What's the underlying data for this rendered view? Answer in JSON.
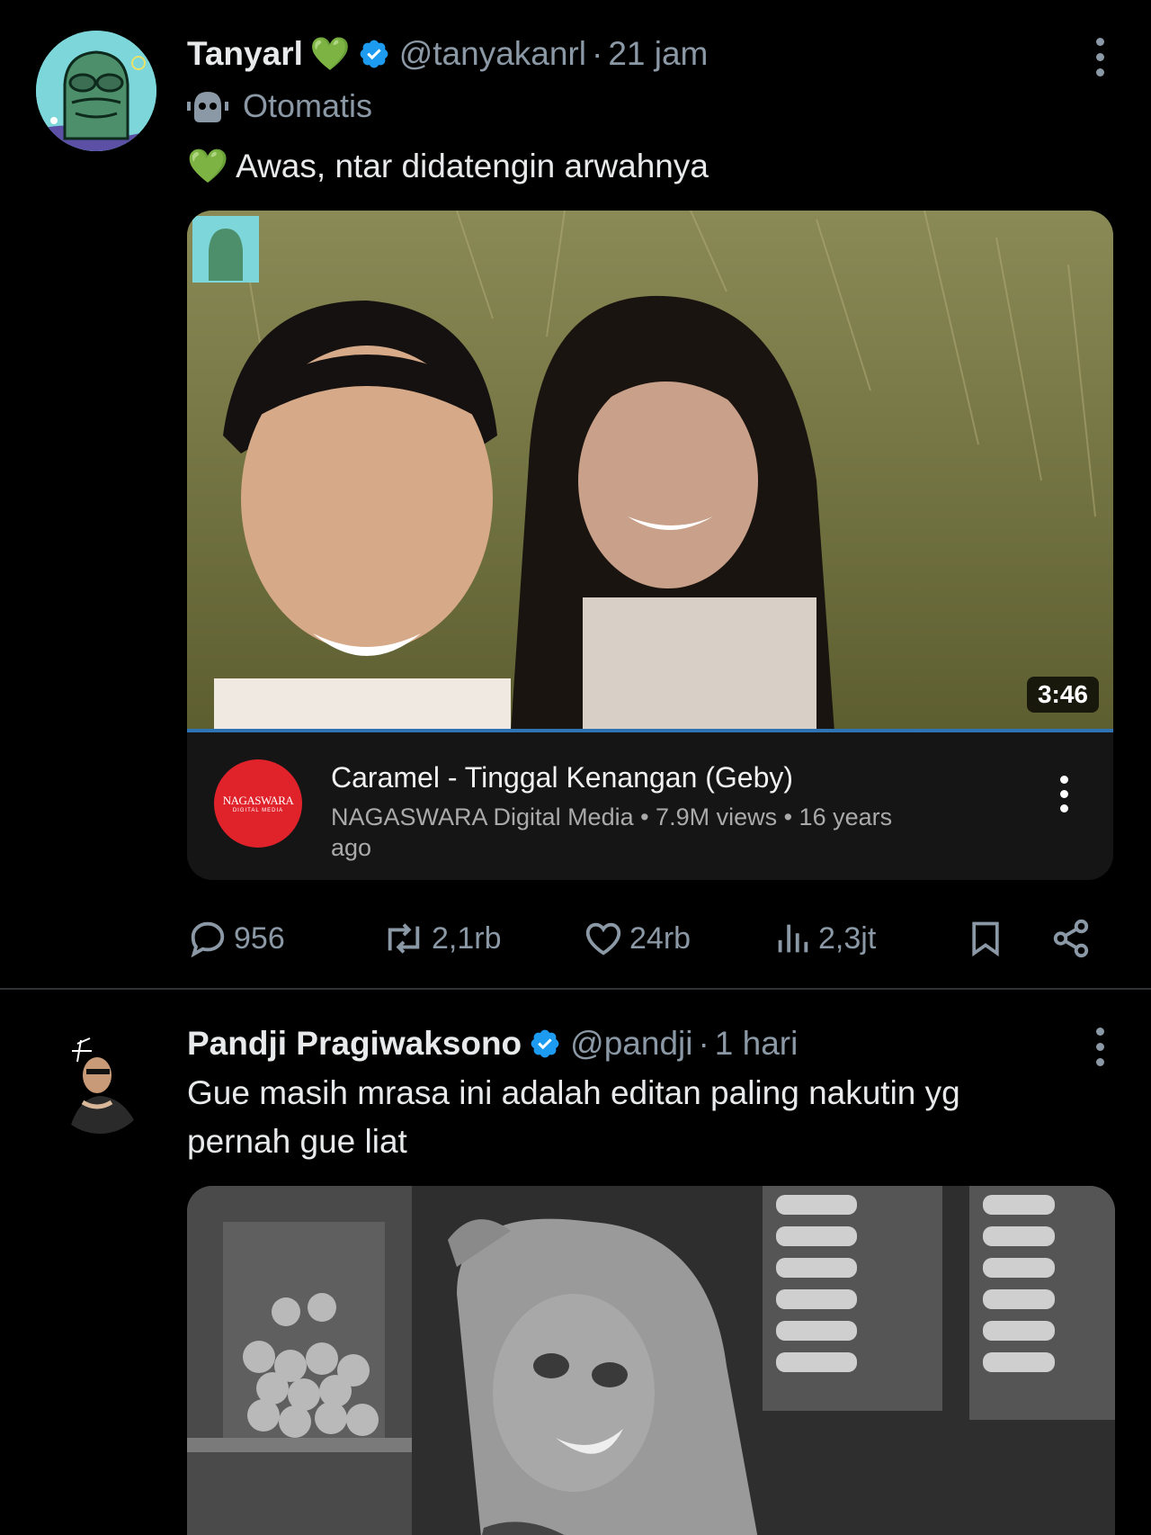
{
  "tweets": [
    {
      "author_name": "Tanyarl",
      "name_emoji": "💚",
      "handle": "@tanyakanrl",
      "separator": "·",
      "time": "21 jam",
      "automated_label": "Otomatis",
      "text_emoji": "💚",
      "text": "Awas, ntar didatengin arwahnya",
      "video_card": {
        "duration": "3:46",
        "title": "Caramel - Tinggal Kenangan (Geby)",
        "channel_line": "NAGASWARA Digital Media • 7.9M views • 16 years",
        "channel_line_2": "ago",
        "channel_logo_text": "NAGASWARA",
        "channel_logo_subtext": "DIGITAL MEDIA"
      },
      "actions": {
        "replies": "956",
        "reposts": "2,1rb",
        "likes": "24rb",
        "views": "2,3jt"
      }
    },
    {
      "author_name": "Pandji Pragiwaksono",
      "handle": "@pandji",
      "separator": "·",
      "time": "1 hari",
      "text": "Gue masih mrasa ini adalah editan paling nakutin yg pernah gue liat"
    }
  ],
  "colors": {
    "background": "#000000",
    "verified": "#1d9bf0",
    "muted_text": "#8b98a5",
    "channel_logo": "#e0222b"
  },
  "icons": [
    "verified-badge-icon",
    "robot-icon",
    "reply-icon",
    "repost-icon",
    "like-icon",
    "views-icon",
    "bookmark-icon",
    "share-icon",
    "more-icon"
  ]
}
